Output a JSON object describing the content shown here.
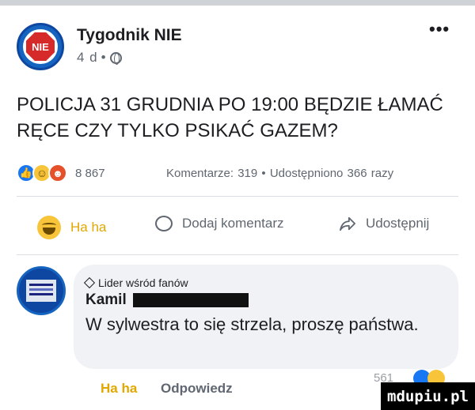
{
  "post": {
    "page_name": "Tygodnik NIE",
    "logo_text": "NIE",
    "time": "4 d",
    "dot": "•",
    "more": "•••",
    "text": "POLICJA 31 GRUDNIA PO 19:00 BĘDZIE ŁAMAĆ RĘCE CZY TYLKO PSIKAĆ GAZEM?"
  },
  "stats": {
    "reaction_count": "8 867",
    "details": "Komentarze: 319 • Udostępniono 366 razy"
  },
  "actions": {
    "haha": "Ha ha",
    "comment": "Dodaj komentarz",
    "share": "Udostępnij"
  },
  "comment": {
    "badge": "Lider wśród fanów",
    "author": "Kamil",
    "text": "W sylwestra to się strzela, proszę państwa.",
    "haha": "Ha ha",
    "reply": "Odpowiedz",
    "count": "561"
  },
  "watermark": "mdupiu.pl",
  "colors": {
    "accent": "#1877f2",
    "haha": "#e0a800",
    "angry": "#e4512a"
  }
}
